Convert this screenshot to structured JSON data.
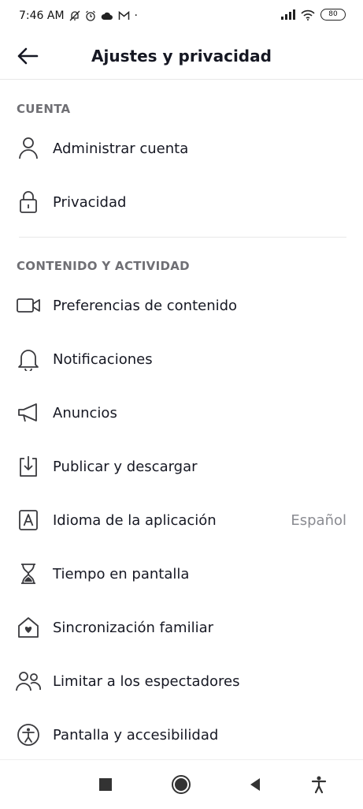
{
  "status_bar": {
    "time": "7:46 AM",
    "dot": "·",
    "battery": "80"
  },
  "header": {
    "title": "Ajustes y privacidad"
  },
  "sections": [
    {
      "title": "CUENTA",
      "items": [
        {
          "label": "Administrar cuenta",
          "icon": "person-icon"
        },
        {
          "label": "Privacidad",
          "icon": "lock-icon"
        }
      ]
    },
    {
      "title": "CONTENIDO Y ACTIVIDAD",
      "items": [
        {
          "label": "Preferencias de contenido",
          "icon": "video-camera-icon"
        },
        {
          "label": "Notificaciones",
          "icon": "bell-icon"
        },
        {
          "label": "Anuncios",
          "icon": "megaphone-icon"
        },
        {
          "label": "Publicar y descargar",
          "icon": "download-icon"
        },
        {
          "label": "Idioma de la aplicación",
          "icon": "language-icon",
          "value": "Español"
        },
        {
          "label": "Tiempo en pantalla",
          "icon": "hourglass-icon"
        },
        {
          "label": "Sincronización familiar",
          "icon": "family-house-icon"
        },
        {
          "label": "Limitar a los espectadores",
          "icon": "people-icon"
        },
        {
          "label": "Pantalla y accesibilidad",
          "icon": "accessibility-icon"
        }
      ]
    }
  ],
  "nav_bar": [
    "square-icon",
    "home-circle-icon",
    "back-triangle-icon",
    "accessibility-person-icon"
  ]
}
